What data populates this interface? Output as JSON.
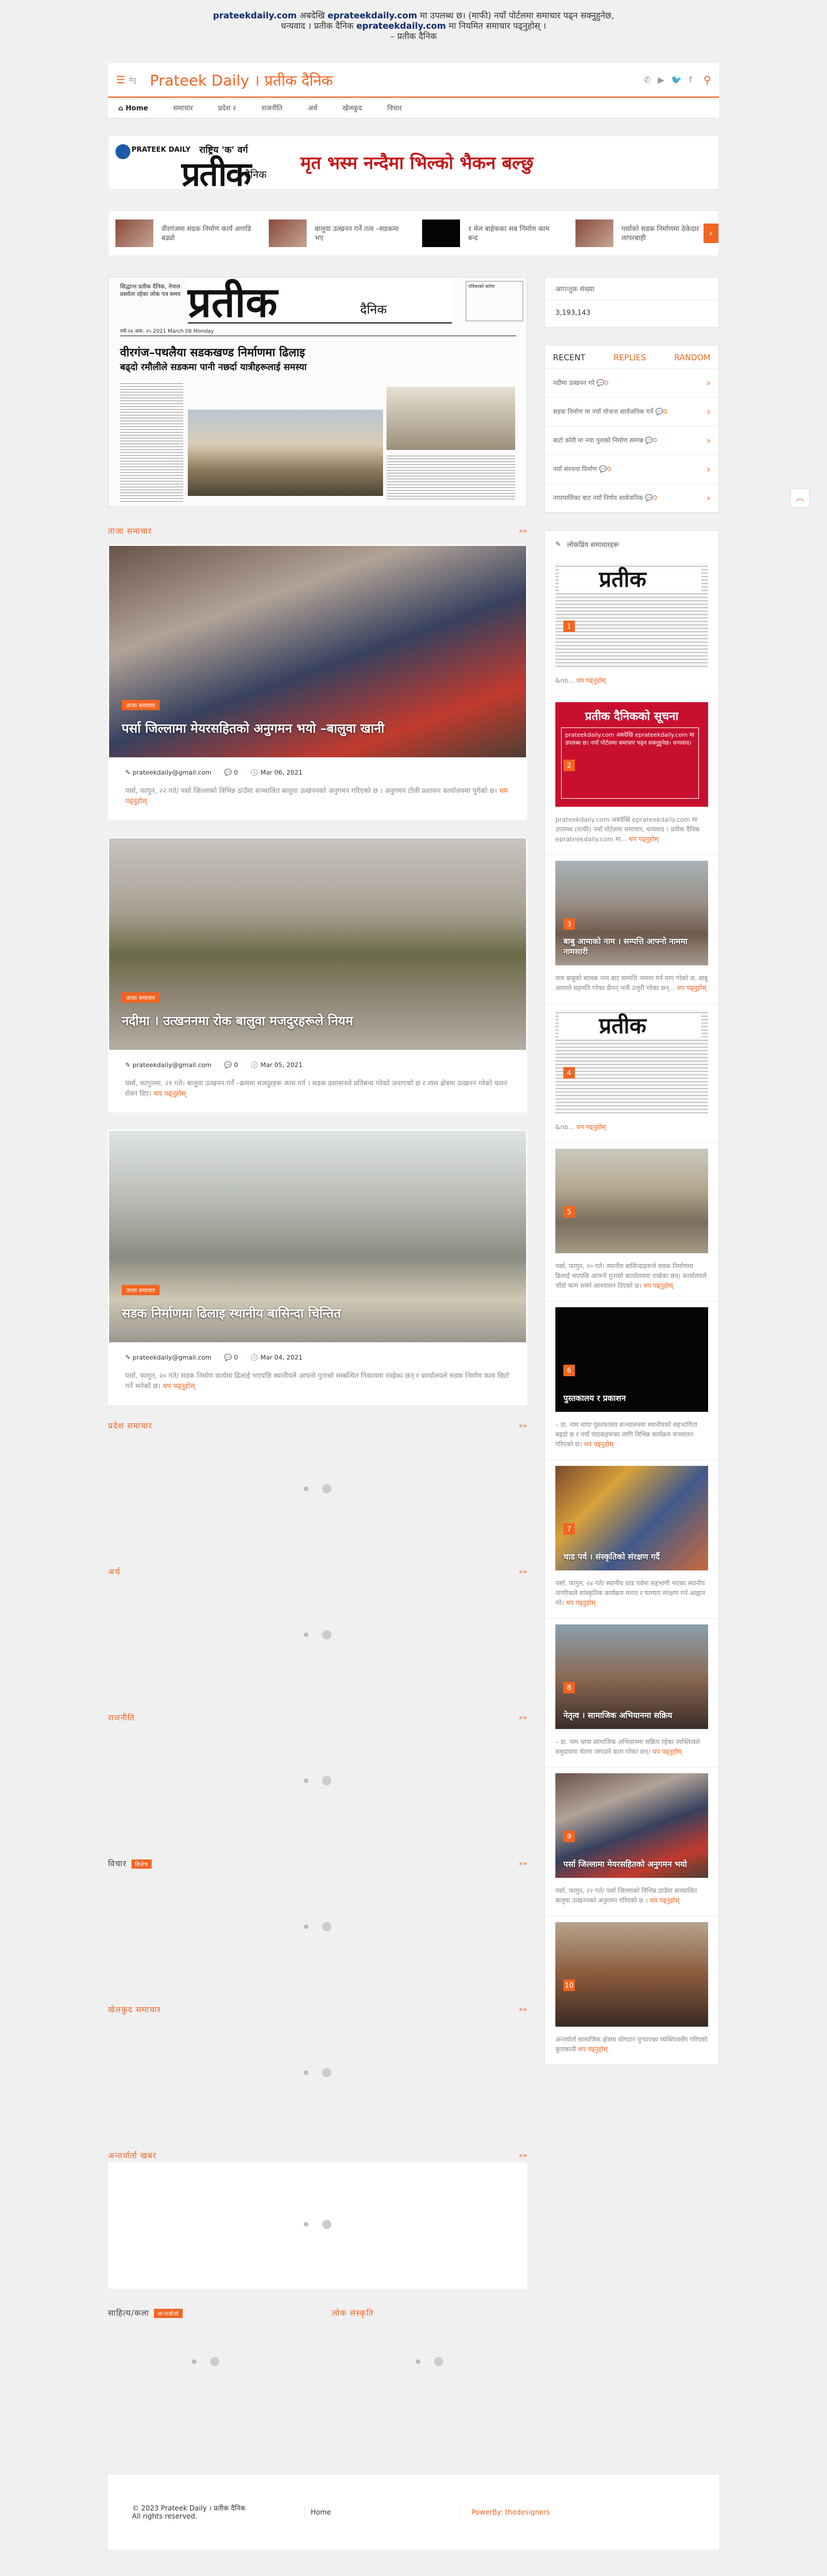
{
  "notice": {
    "line1_a": "prateekdaily.com",
    "line1_b": " अबदेखि ",
    "line1_c": "eprateekdaily.com",
    "line1_d": " मा उपलब्ध छ। (माफी) नयाँ पोर्टलमा समाचार पढ्न सक्नुहुनेछ,",
    "line2_a": "धन्यवाद । प्रतीक दैनिक ",
    "line2_b": "eprateekdaily.com",
    "line2_c": " मा नियमित समाचार पढ्नुहोस् ।",
    "line3": "– प्रतीक दैनिक"
  },
  "header": {
    "menu_label": "मेनु",
    "site_title": "Prateek Daily । प्रतीक दैनिक",
    "social_icons": [
      "whatsapp-icon",
      "youtube-icon",
      "twitter-icon",
      "facebook-icon"
    ],
    "search_icon": "search-icon"
  },
  "nav": {
    "items": [
      "Home",
      "समाचार",
      "प्रदेश २",
      "राजनीति",
      "अर्थ",
      "खेलकुद",
      "विचार"
    ]
  },
  "banner": {
    "daily": "PRATEEK DAILY",
    "tag": "राष्ट्रिय 'क' वर्ग",
    "logo": "प्रतीक",
    "dainik": "दैनिक",
    "headline": "मृत भस्म नन्दैमा भिल्को भैकन बल्छु"
  },
  "ticker": [
    {
      "text": "वीरगंजमा सडक निर्माण कार्य अगाडि बढ्यो"
    },
    {
      "text": "बालुवा उत्खनन गर्ने तत्व –सडकमा भए"
    },
    {
      "text": "१ मेल बाहेकका सब निर्माण काम बन्द"
    },
    {
      "text": "पर्साको सडक निर्माणमा ठेकेदार लापरबाही"
    }
  ],
  "hero_paper": {
    "masthead": "प्रतीक",
    "dainik": "दैनिक",
    "left_box": "सिद्धान्त प्रतीक दैनिक, नेपाल प्रस्तोता रहेका लोक पत्र समय",
    "date": "वर्ष:२४ अंक: २५ 2021 March 08 Monday",
    "headline": "वीरगंज–पथलैया सडकखण्ड निर्माणमा ढिलाइ",
    "subhead": "बढ्दो रमौलीले सडकमा पानी नछर्दा यात्रीहरूलाई समस्या",
    "side_box": "पत्रिकाको बारेमा"
  },
  "sections": {
    "s1": "ताजा समाचार",
    "s2": "प्रदेश समाचार",
    "s3": "अर्थ",
    "s4": "राजनीति",
    "s5": "विचार",
    "s5_badge": "विशेष",
    "s6": "खेलकुद समाचार",
    "s7": "अन्तर्वार्ता खबर",
    "s8": "साहित्य/कला",
    "s8_badge": "अन्तर्वार्ता",
    "s9": "लोक संस्कृति",
    "more": "»»"
  },
  "articles": [
    {
      "category": "ताजा समाचार",
      "title": "पर्सा जिल्लामा मेयरसहितको अनुगमन भयो –बालुवा खानी",
      "email": "prateekdaily@gmail.com",
      "comments": "0",
      "date": "Mar 06, 2021",
      "excerpt": "पर्सा, फागुन, २२ गते/ पर्सा जिल्लाको विभिन्न ठाउँमा सञ्चालित बालुवा उत्खननको अनुगमन गरिएको छ । अनुगमन टोली प्रशासन कार्यालयमा पुगेको छ।",
      "read_more": "थप पढ्नुहोस्"
    },
    {
      "category": "ताजा समाचार",
      "title": "नदीमा । उत्खननमा रोक बालुवा मजदुरहरूले नियम",
      "email": "prateekdaily@gmail.com",
      "comments": "0",
      "date": "Mar 05, 2021",
      "excerpt": "पर्सा, फागुनमा, २१ गते। बालुवा उत्खनन गर्ने –क्रममा मजदुरहरू काम गर्न । सडक प्रशासनले प्रतिबन्ध गरेको जनाएको छ र त्यस क्षेत्रमा उत्खनन गरेको चलन रोक्न दिए।",
      "read_more": "थप पढ्नुहोस्"
    },
    {
      "category": "ताजा समाचार",
      "title": "सडक निर्माणमा ढिलाइ स्थानीय बासिन्दा चिन्तित",
      "email": "prateekdaily@gmail.com",
      "comments": "0",
      "date": "Mar 04, 2021",
      "excerpt": "पर्सा, फागुन, २० गते/ सडक निर्माण कार्यमा ढिलाई भएपछि स्थानीयले आफ्नो गुनासो सम्बन्धित निकायमा राखेका छन् र कार्यालयले सडक निर्माण काम छिटो गर्ने भनेको छ।",
      "read_more": "थप पढ्नुहोस्"
    }
  ],
  "sidebar": {
    "visitors_title": "आगन्तुक संख्या",
    "visitors_count": "3,193,143",
    "tabs": [
      "RECENT",
      "REPLIES",
      "RANDOM"
    ],
    "recent": [
      {
        "title": "नदीमा उत्खनन गरे",
        "comments": "0"
      },
      {
        "title": "सडक निर्माण मा नयाँ योजना सार्वजनिक गर्ने",
        "comments": "0"
      },
      {
        "title": "बाटो कोरी मा नया पुलको निर्माण सम्पन्न",
        "comments": "0"
      },
      {
        "title": "नयाँ संरचना निर्माण",
        "comments": "0"
      },
      {
        "title": "नगरपालिका बाट नयाँ निर्णय सार्वजनिक",
        "comments": "0"
      }
    ],
    "popular_title": "लोकप्रिय समाचारहरू",
    "popular": [
      {
        "num": "1",
        "title": "",
        "excerpt": "&nb...",
        "read_more": "थप पढ्नुहोस्",
        "style": "paper",
        "logo": "प्रतीक"
      },
      {
        "num": "2",
        "title": "",
        "excerpt": "prateekdaily.com अबदेखि eprateekdaily.com मा उपलब्ध (माफी) नयाँ पोर्टलमा समाचार, धन्यवाद । प्रतीक दैनिक eprateekdaily.com मा...",
        "read_more": "थप पढ्नुहोस्",
        "style": "red",
        "red_head": "प्रतीक दैनिकको सूचना",
        "red_body": "prateekdaily.com अबदेखि eprateekdaily.com मा उपलब्ध छ। नयाँ पोर्टलमा समाचार पढ्न सक्नुहुनेछ। धन्यवाद।"
      },
      {
        "num": "3",
        "title": "बाबु आमाको नाम । सम्पत्ति आफ्नो नाममा नामसारी",
        "excerpt": "नाम बाबुको  बालक नाम बाट सम्पत्ति नाममा गर्न माग गरेको छ, बाबु आमाले सहमति गरेका छैनन् भनी उजुरी गरेका छन्...",
        "read_more": "थप पढ्नुहोस्",
        "style": "street"
      },
      {
        "num": "4",
        "title": "",
        "excerpt": "&nb...",
        "read_more": "थप पढ्नुहोस्",
        "style": "paper",
        "logo": "प्रतीक"
      },
      {
        "num": "5",
        "title": "",
        "excerpt": "पर्सा, फागुन, २० गते। स्थानीय बासिन्दाहरूले सडक निर्माणमा ढिलाई भएपछि आफ्नो गुनासो कार्यालयमा राखेका छन्। कार्यालयले चाँडो काम सक्ने आश्वासन दिएको छ।",
        "read_more": "थप पढ्नुहोस्",
        "style": "road"
      },
      {
        "num": "6",
        "title": "पुस्तकालय र प्रकाशन",
        "excerpt": "– डा. नाम थापा    पुस्तकालय सञ्चालनमा स्थानीयको सहभागिता बढ्दो छ र नयाँ पाठकहरूका लागि विभिन्न कार्यक्रम सञ्चालन गरिएको छ।",
        "read_more": "थप पढ्नुहोस्",
        "style": "black"
      },
      {
        "num": "7",
        "title": "चाड पर्व । संस्कृतिको संरक्षण गर्दै",
        "excerpt": "पर्सा, फागुन, २४ गते/ स्थानीय चाड पर्वमा सहभागी भएका स्थानीय नागरिकले सांस्कृतिक कार्यक्रम मनाए र परम्परा संरक्षण गर्न आह्वान गरे।",
        "read_more": "थप पढ्नुहोस्",
        "style": "fest"
      },
      {
        "num": "8",
        "title": "नेतृत्व । सामाजिक अभियानमा सक्रिय",
        "excerpt": "– डा. नाम थापा    सामाजिक अभियानमा सक्रिय रहेका व्यक्तित्वले समुदायमा चेतना जगाउने काम गरेका छन्।",
        "read_more": "थप पढ्नुहोस्",
        "style": "man"
      },
      {
        "num": "9",
        "title": "पर्सा जिल्लामा मेयरसहितको अनुगमन भयो",
        "excerpt": "पर्सा, फागुन, २२ गते/ पर्सा जिल्लाको विभिन्न ठाउँमा सञ्चालित बालुवा उत्खननको अनुगमन गरिएको छ ।",
        "read_more": "थप पढ्नुहोस्",
        "style": "crowd"
      },
      {
        "num": "10",
        "title": "",
        "excerpt": "अन्तर्वार्ता  सामाजिक क्षेत्रमा योगदान पुर्‍याएका व्यक्तित्वसँग गरिएको कुराकानी",
        "read_more": "थप पढ्नुहोस्",
        "style": "man2"
      }
    ]
  },
  "footer": {
    "copyright": "© 2023 Prateek Daily । प्रतीक दैनिक",
    "rights": "All rights reserved.",
    "home": "Home",
    "powered": "PowerBy: thedesigners"
  },
  "colors": {
    "accent": "#f26522",
    "banner_red": "#c41818",
    "notice_blue": "#0b2a6b"
  }
}
